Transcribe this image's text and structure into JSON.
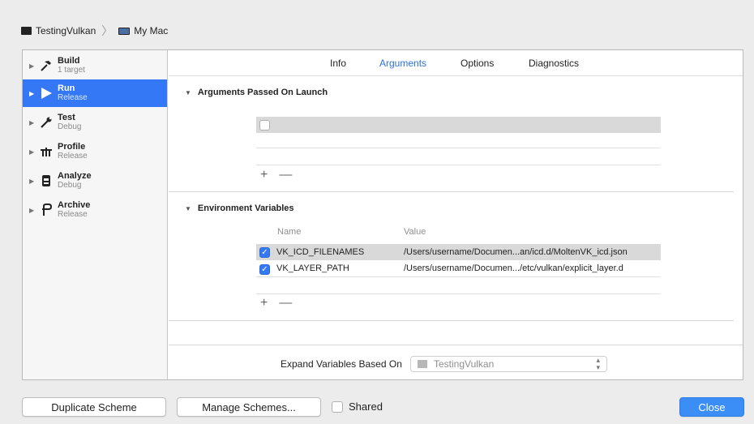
{
  "pathbar": {
    "scheme": "TestingVulkan",
    "destination": "My Mac"
  },
  "sidebar": {
    "items": [
      {
        "title": "Build",
        "subtitle": "1 target",
        "icon": "hammer-icon",
        "selected": false
      },
      {
        "title": "Run",
        "subtitle": "Release",
        "icon": "play-icon",
        "selected": true
      },
      {
        "title": "Test",
        "subtitle": "Debug",
        "icon": "wrench-icon",
        "selected": false
      },
      {
        "title": "Profile",
        "subtitle": "Release",
        "icon": "profile-icon",
        "selected": false
      },
      {
        "title": "Analyze",
        "subtitle": "Debug",
        "icon": "analyze-icon",
        "selected": false
      },
      {
        "title": "Archive",
        "subtitle": "Release",
        "icon": "archive-icon",
        "selected": false
      }
    ]
  },
  "tabs": [
    {
      "label": "Info",
      "active": false
    },
    {
      "label": "Arguments",
      "active": true
    },
    {
      "label": "Options",
      "active": false
    },
    {
      "label": "Diagnostics",
      "active": false
    }
  ],
  "arguments": {
    "title": "Arguments Passed On Launch",
    "add": "+",
    "remove": "—"
  },
  "environment": {
    "title": "Environment Variables",
    "col_name": "Name",
    "col_value": "Value",
    "rows": [
      {
        "name": "VK_ICD_FILENAMES",
        "value": "/Users/username/Documen...an/icd.d/MoltenVK_icd.json",
        "checked": true
      },
      {
        "name": "VK_LAYER_PATH",
        "value": "/Users/username/Documen.../etc/vulkan/explicit_layer.d",
        "checked": true
      }
    ],
    "add": "+",
    "remove": "—"
  },
  "expand": {
    "label": "Expand Variables Based On",
    "value": "TestingVulkan"
  },
  "footer": {
    "duplicate": "Duplicate Scheme",
    "manage": "Manage Schemes...",
    "shared": "Shared",
    "close": "Close"
  },
  "colors": {
    "accent": "#3478f6",
    "active_tab": "#2c6fdd"
  }
}
